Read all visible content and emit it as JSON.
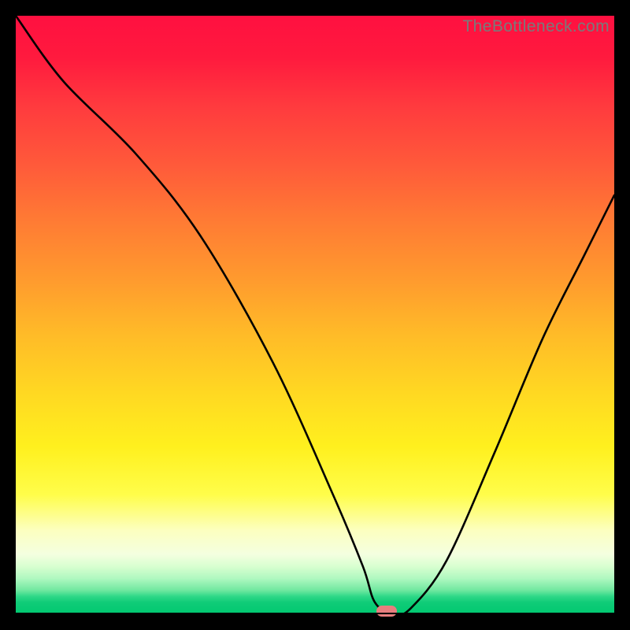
{
  "attribution": "TheBottleneck.com",
  "chart_data": {
    "type": "line",
    "title": "",
    "xlabel": "",
    "ylabel": "",
    "xlim": [
      0,
      100
    ],
    "ylim": [
      0,
      100
    ],
    "series": [
      {
        "name": "bottleneck",
        "x": [
          0,
          8,
          20,
          31,
          43,
          53,
          58,
          60,
          63,
          66,
          72,
          80,
          88,
          95,
          100
        ],
        "values": [
          100,
          89,
          77,
          63,
          42,
          20,
          8,
          2,
          0,
          1,
          9,
          27,
          46,
          60,
          70
        ]
      }
    ],
    "marker": {
      "x": 62,
      "y": 0
    }
  },
  "colors": {
    "marker": "#e77e7e",
    "curve": "#000000"
  }
}
